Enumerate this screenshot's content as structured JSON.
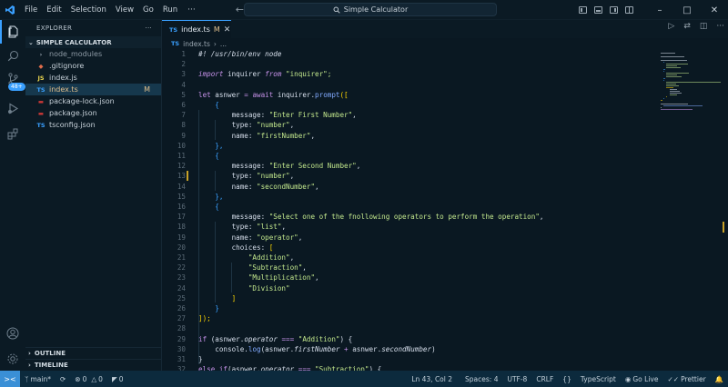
{
  "titlebar": {
    "menu": [
      "File",
      "Edit",
      "Selection",
      "View",
      "Go",
      "Run"
    ],
    "more": "···",
    "search_text": "Simple Calculator"
  },
  "explorer": {
    "header": "EXPLORER",
    "more": "···",
    "folder": "SIMPLE CALCULATOR",
    "files": [
      {
        "name": "node_modules",
        "icon": "›",
        "icon_color": "#9aa7b1",
        "color": "#8d9aa5"
      },
      {
        "name": ".gitignore",
        "icon": "◆",
        "icon_color": "#e06c4b",
        "color": "#c5cfd7"
      },
      {
        "name": "index.js",
        "icon": "JS",
        "icon_color": "#e8d44d",
        "color": "#c5cfd7"
      },
      {
        "name": "index.ts",
        "icon": "TS",
        "icon_color": "#3aa0ff",
        "color": "#e2c08d",
        "modified": "M"
      },
      {
        "name": "package-lock.json",
        "icon": "▬",
        "icon_color": "#cb3837",
        "color": "#c5cfd7"
      },
      {
        "name": "package.json",
        "icon": "▬",
        "icon_color": "#cb3837",
        "color": "#c5cfd7"
      },
      {
        "name": "tsconfig.json",
        "icon": "TS",
        "icon_color": "#3aa0ff",
        "color": "#c5cfd7"
      }
    ],
    "outline": "OUTLINE",
    "timeline": "TIMELINE"
  },
  "activity": {
    "source_control_badge": "48+"
  },
  "editor": {
    "tab_icon": "TS",
    "tab_label": "index.ts",
    "tab_modified": "M",
    "breadcrumb_icon": "TS",
    "breadcrumb_file": "index.ts",
    "breadcrumb_sep": "›",
    "breadcrumb_more": "...",
    "lines": [
      {
        "n": "1",
        "tokens": [
          [
            "#! /usr/bin/env node",
            "#d6deeb",
            "i"
          ]
        ]
      },
      {
        "n": "2",
        "tokens": []
      },
      {
        "n": "3",
        "tokens": [
          [
            "import",
            "#c792ea",
            "i"
          ],
          [
            " inquirer ",
            "#d6deeb"
          ],
          [
            "from",
            "#c792ea",
            "i"
          ],
          [
            " \"inquirer\";",
            "#c3e88d"
          ]
        ]
      },
      {
        "n": "4",
        "tokens": []
      },
      {
        "n": "5",
        "tokens": [
          [
            "let",
            "#c792ea"
          ],
          [
            " asnwer ",
            "#d6deeb"
          ],
          [
            "=",
            "#c792ea"
          ],
          [
            " await ",
            "#c792ea"
          ],
          [
            "inquirer",
            "#d6deeb"
          ],
          [
            ".",
            "#d6deeb"
          ],
          [
            "prompt",
            "#82aaff"
          ],
          [
            "([",
            "#ffd700"
          ]
        ]
      },
      {
        "n": "6",
        "tokens": [
          [
            "    {",
            "#3aa0ff"
          ]
        ]
      },
      {
        "n": "7",
        "tokens": [
          [
            "        message: ",
            "#d6deeb"
          ],
          [
            "\"Enter First Number\"",
            "#c3e88d"
          ],
          [
            ",",
            "#d6deeb"
          ]
        ]
      },
      {
        "n": "8",
        "tokens": [
          [
            "        type: ",
            "#d6deeb"
          ],
          [
            "\"number\"",
            "#c3e88d"
          ],
          [
            ",",
            "#d6deeb"
          ]
        ]
      },
      {
        "n": "9",
        "tokens": [
          [
            "        name: ",
            "#d6deeb"
          ],
          [
            "\"firstNumber\"",
            "#c3e88d"
          ],
          [
            ",",
            "#d6deeb"
          ]
        ]
      },
      {
        "n": "10",
        "tokens": [
          [
            "    },",
            "#3aa0ff"
          ]
        ]
      },
      {
        "n": "11",
        "tokens": [
          [
            "    {",
            "#3aa0ff"
          ]
        ]
      },
      {
        "n": "12",
        "tokens": [
          [
            "        message: ",
            "#d6deeb"
          ],
          [
            "\"Enter Second Number\"",
            "#c3e88d"
          ],
          [
            ",",
            "#d6deeb"
          ]
        ]
      },
      {
        "n": "13",
        "tokens": [
          [
            "        type: ",
            "#d6deeb"
          ],
          [
            "\"number\"",
            "#c3e88d"
          ],
          [
            ",",
            "#d6deeb"
          ]
        ]
      },
      {
        "n": "14",
        "tokens": [
          [
            "        name: ",
            "#d6deeb"
          ],
          [
            "\"secondNumber\"",
            "#c3e88d"
          ],
          [
            ",",
            "#d6deeb"
          ]
        ]
      },
      {
        "n": "15",
        "tokens": [
          [
            "    },",
            "#3aa0ff"
          ]
        ]
      },
      {
        "n": "16",
        "tokens": [
          [
            "    {",
            "#3aa0ff"
          ]
        ]
      },
      {
        "n": "17",
        "tokens": [
          [
            "        message: ",
            "#d6deeb"
          ],
          [
            "\"Select one of the fnollowing operators to perform the operation\"",
            "#c3e88d"
          ],
          [
            ",",
            "#d6deeb"
          ]
        ]
      },
      {
        "n": "18",
        "tokens": [
          [
            "        type: ",
            "#d6deeb"
          ],
          [
            "\"list\"",
            "#c3e88d"
          ],
          [
            ",",
            "#d6deeb"
          ]
        ]
      },
      {
        "n": "19",
        "tokens": [
          [
            "        name: ",
            "#d6deeb"
          ],
          [
            "\"operator\"",
            "#c3e88d"
          ],
          [
            ",",
            "#d6deeb"
          ]
        ]
      },
      {
        "n": "20",
        "tokens": [
          [
            "        choices: ",
            "#d6deeb"
          ],
          [
            "[",
            "#ffd700"
          ]
        ]
      },
      {
        "n": "21",
        "tokens": [
          [
            "            \"Addition\"",
            "#c3e88d"
          ],
          [
            ",",
            "#d6deeb"
          ]
        ]
      },
      {
        "n": "22",
        "tokens": [
          [
            "            \"Subtraction\"",
            "#c3e88d"
          ],
          [
            ",",
            "#d6deeb"
          ]
        ]
      },
      {
        "n": "23",
        "tokens": [
          [
            "            \"Multiplication\"",
            "#c3e88d"
          ],
          [
            ",",
            "#d6deeb"
          ]
        ]
      },
      {
        "n": "24",
        "tokens": [
          [
            "            \"Division\"",
            "#c3e88d"
          ]
        ]
      },
      {
        "n": "25",
        "tokens": [
          [
            "        ]",
            "#ffd700"
          ]
        ]
      },
      {
        "n": "26",
        "tokens": [
          [
            "    }",
            "#3aa0ff"
          ]
        ]
      },
      {
        "n": "27",
        "tokens": [
          [
            "]);",
            "#ffd700"
          ]
        ]
      },
      {
        "n": "28",
        "tokens": []
      },
      {
        "n": "29",
        "tokens": [
          [
            "if",
            "#c792ea"
          ],
          [
            " (asnwer.",
            "#d6deeb"
          ],
          [
            "operator",
            "#d6deeb",
            "i"
          ],
          [
            " === ",
            "#c792ea"
          ],
          [
            "\"Addition\"",
            "#c3e88d"
          ],
          [
            ") {",
            "#d6deeb"
          ]
        ]
      },
      {
        "n": "30",
        "tokens": [
          [
            "    console.",
            "#d6deeb"
          ],
          [
            "log",
            "#82aaff"
          ],
          [
            "(asnwer.",
            "#d6deeb"
          ],
          [
            "firstNumber",
            "#d6deeb",
            "i"
          ],
          [
            " + ",
            "#c792ea"
          ],
          [
            "asnwer.",
            "#d6deeb"
          ],
          [
            "secondNumber",
            "#d6deeb",
            "i"
          ],
          [
            ")",
            "#d6deeb"
          ]
        ]
      },
      {
        "n": "31",
        "tokens": [
          [
            "}",
            "#d6deeb"
          ]
        ]
      },
      {
        "n": "32",
        "tokens": [
          [
            "else ",
            "#c792ea"
          ],
          [
            "if",
            "#c792ea"
          ],
          [
            "(asnwer.",
            "#d6deeb"
          ],
          [
            "operator",
            "#d6deeb",
            "i"
          ],
          [
            " === ",
            "#c792ea"
          ],
          [
            "\"Subtraction\"",
            "#c3e88d"
          ],
          [
            ") {",
            "#d6deeb"
          ]
        ]
      }
    ]
  },
  "statusbar": {
    "remote_icon": "><",
    "branch": "main*",
    "sync": "⟳",
    "errors": "0",
    "warnings": "0",
    "ports": "0",
    "position": "Ln 43, Col 2",
    "spaces": "Spaces: 4",
    "encoding": "UTF-8",
    "eol": "CRLF",
    "braces": "{}",
    "language": "TypeScript",
    "golive": "Go Live",
    "prettier": "Prettier",
    "bell": "♪"
  },
  "colors": {
    "accent": "#3aa0ff",
    "modified": "#e2c08d",
    "statusbar": "#0c2a3d"
  }
}
